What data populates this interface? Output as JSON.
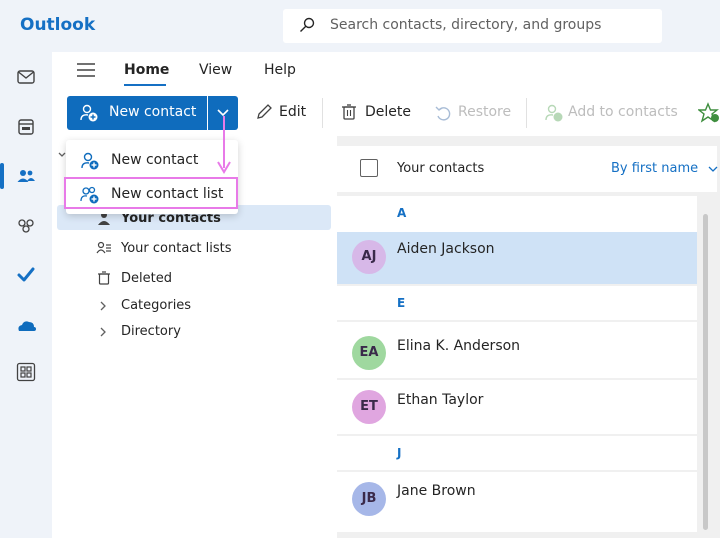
{
  "app": {
    "title": "Outlook"
  },
  "search": {
    "placeholder": "Search contacts, directory, and groups"
  },
  "rail": {
    "icons": [
      "mail-icon",
      "calendar-icon",
      "people-icon",
      "groups-icon",
      "todo-icon",
      "onedrive-icon",
      "apps-icon"
    ]
  },
  "tabs": [
    {
      "label": "Home"
    },
    {
      "label": "View"
    },
    {
      "label": "Help"
    }
  ],
  "toolbar": {
    "new_contact": "New contact",
    "edit": "Edit",
    "delete": "Delete",
    "restore": "Restore",
    "add_to_contacts": "Add to contacts"
  },
  "dropdown_menu": {
    "items": [
      {
        "label": "New contact"
      },
      {
        "label": "New contact list"
      }
    ]
  },
  "folders": {
    "items": [
      {
        "label": "Your contacts"
      },
      {
        "label": "Your contact lists"
      },
      {
        "label": "Deleted"
      },
      {
        "label": "Categories"
      },
      {
        "label": "Directory"
      }
    ]
  },
  "contact_list": {
    "title": "Your contacts",
    "sort_label": "By first name",
    "sections": [
      {
        "letter": "A",
        "contacts": [
          {
            "initials": "AJ",
            "name": "Aiden Jackson",
            "selected": true
          }
        ]
      },
      {
        "letter": "E",
        "contacts": [
          {
            "initials": "EA",
            "name": "Elina K. Anderson"
          },
          {
            "initials": "ET",
            "name": "Ethan Taylor"
          }
        ]
      },
      {
        "letter": "J",
        "contacts": [
          {
            "initials": "JB",
            "name": "Jane Brown"
          }
        ]
      }
    ]
  },
  "colors": {
    "accent": "#0f6cbd",
    "highlight": "#e87ae8",
    "avatar_aj": "#d7b8e8",
    "avatar_ea": "#9fd89f",
    "avatar_et": "#e0a6e0",
    "avatar_jb": "#a6b7e8"
  }
}
